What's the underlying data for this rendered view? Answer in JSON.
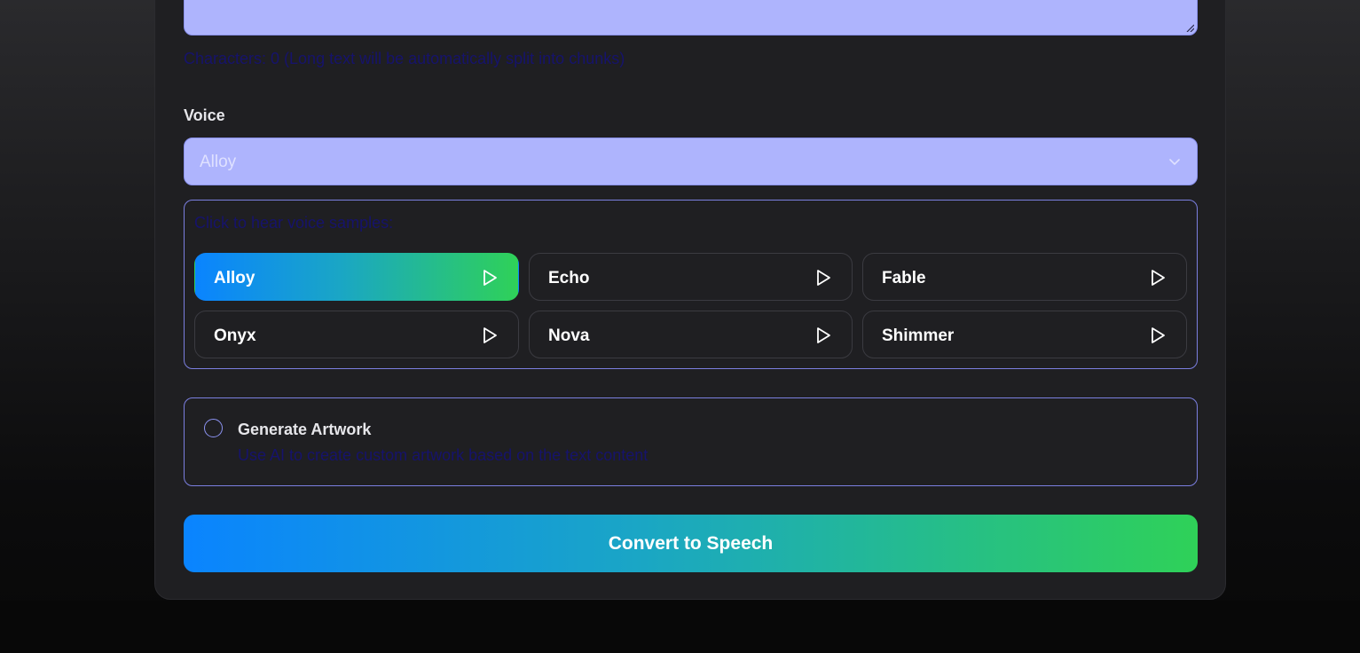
{
  "text_input": {
    "value": "",
    "char_count_text": "Characters: 0 (Long text will be automatically split into chunks)"
  },
  "voice": {
    "label": "Voice",
    "selected": "Alloy",
    "samples_hint": "Click to hear voice samples:",
    "options": [
      {
        "name": "Alloy",
        "active": true
      },
      {
        "name": "Echo",
        "active": false
      },
      {
        "name": "Fable",
        "active": false
      },
      {
        "name": "Onyx",
        "active": false
      },
      {
        "name": "Nova",
        "active": false
      },
      {
        "name": "Shimmer",
        "active": false
      }
    ]
  },
  "artwork": {
    "checked": false,
    "title": "Generate Artwork",
    "description": "Use AI to create custom artwork based on the text content"
  },
  "convert": {
    "label": "Convert to Speech"
  },
  "colors": {
    "accent_start": "#0a84ff",
    "accent_end": "#2fd158",
    "input_bg": "#aeb4fd",
    "card_bg": "#1f1f22",
    "border_accent": "#7b7fe0"
  },
  "icons": {
    "play": "play-icon",
    "chevron": "chevron-down-icon",
    "resize": "resize-grip-icon"
  }
}
